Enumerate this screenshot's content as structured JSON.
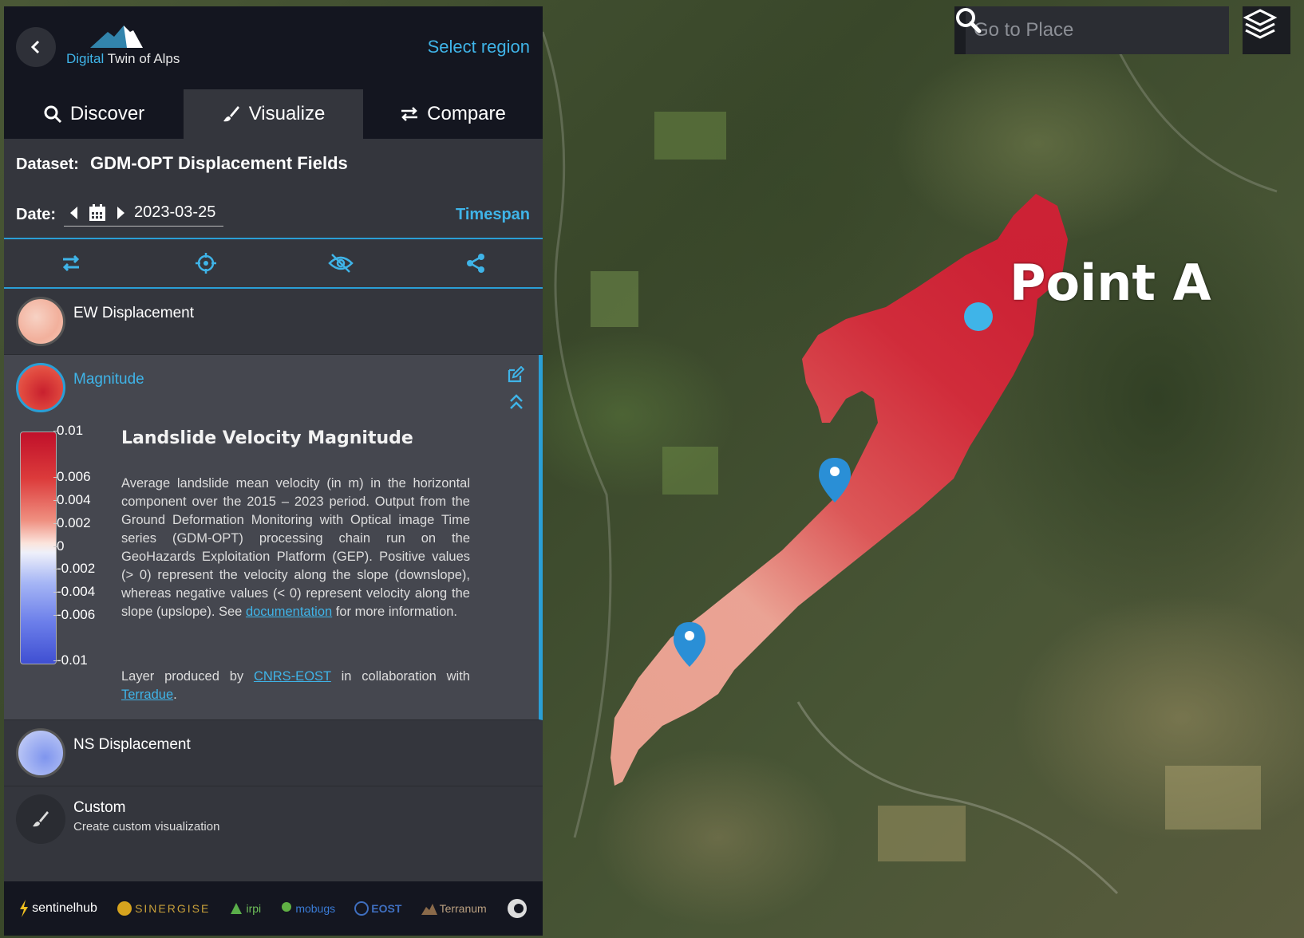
{
  "header": {
    "logo_word1": "Digital",
    "logo_word2": "Twin of Alps",
    "select_region": "Select region"
  },
  "tabs": [
    {
      "label": "Discover",
      "icon": "search-icon",
      "active": false
    },
    {
      "label": "Visualize",
      "icon": "brush-icon",
      "active": true
    },
    {
      "label": "Compare",
      "icon": "compare-arrows-icon",
      "active": false
    }
  ],
  "dataset": {
    "label": "Dataset:",
    "name": "GDM-OPT Displacement Fields"
  },
  "date": {
    "label": "Date:",
    "value": "2023-03-25",
    "timespan": "Timespan"
  },
  "layers": {
    "ew": {
      "title": "EW Displacement"
    },
    "magnitude": {
      "title": "Magnitude",
      "legend_ticks": [
        "0.01",
        "0.006",
        "0.004",
        "0.002",
        "0",
        "-0.002",
        "-0.004",
        "-0.006",
        "-0.01"
      ],
      "desc_title": "Landslide Velocity Magnitude",
      "desc_text": "Average landslide mean velocity (in m) in the horizontal component over the 2015 – 2023 period. Output from the Ground Deformation Monitoring with Optical image Time series (GDM-OPT) processing chain run on the GeoHazards Exploitation Platform (GEP). Positive values (> 0) represent the velocity along the slope (downslope), whereas negative values (< 0) represent velocity along the slope (upslope). See",
      "desc_link": "documentation",
      "desc_tail": "for more information.",
      "credit_pre": "Layer produced by",
      "credit_link1": "CNRS-EOST",
      "credit_mid": "in collaboration with",
      "credit_link2": "Terradue",
      "credit_end": "."
    },
    "ns": {
      "title": "NS Displacement"
    },
    "custom": {
      "title": "Custom",
      "subtitle": "Create custom visualization"
    }
  },
  "footer_logos": [
    "sentinelhub",
    "SINERGISE",
    "irpi",
    "mobugs",
    "EOST",
    "Terranum"
  ],
  "map": {
    "search_placeholder": "Go to Place",
    "point_label": "Point A"
  },
  "colors": {
    "accent": "#3fb4e8",
    "panel": "#34363d",
    "header": "#141620"
  }
}
